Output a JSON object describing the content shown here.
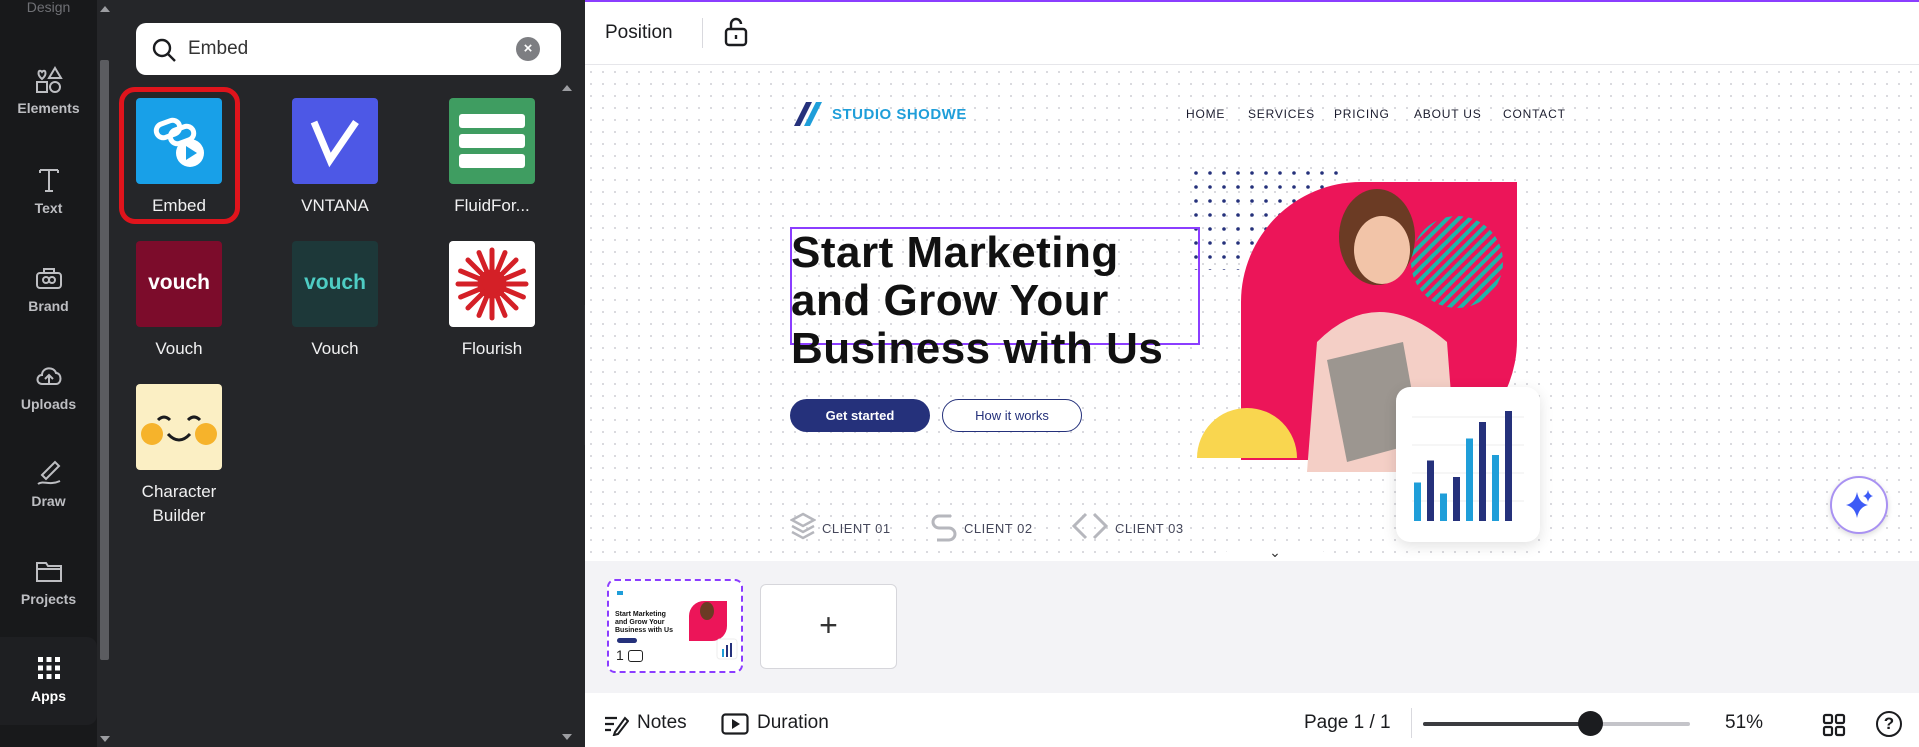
{
  "rail": {
    "top_label": "Design",
    "items": [
      {
        "label": "Elements",
        "icon": "elements-icon"
      },
      {
        "label": "Text",
        "icon": "text-icon"
      },
      {
        "label": "Brand",
        "icon": "brand-icon"
      },
      {
        "label": "Uploads",
        "icon": "uploads-icon"
      },
      {
        "label": "Draw",
        "icon": "draw-icon"
      },
      {
        "label": "Projects",
        "icon": "projects-icon"
      },
      {
        "label": "Apps",
        "icon": "apps-icon",
        "active": true
      }
    ]
  },
  "search": {
    "value": "Embed",
    "placeholder": "Search"
  },
  "apps": [
    {
      "label": "Embed",
      "icon": "embed-icon",
      "color": "#18a0e8",
      "highlighted": true
    },
    {
      "label": "VNTANA",
      "icon": "vntana-icon",
      "color": "#4d58e6"
    },
    {
      "label": "FluidFor...",
      "icon": "fluidforms-icon",
      "color": "#3f9d61"
    },
    {
      "label": "Vouch",
      "icon": "vouch-red-icon",
      "color": "#7c0c2b",
      "logo_text": "vouch"
    },
    {
      "label": "Vouch",
      "icon": "vouch-dark-icon",
      "color": "#1d3839",
      "logo_text": "vouch"
    },
    {
      "label": "Flourish",
      "icon": "flourish-icon",
      "color": "#ffffff"
    },
    {
      "label": "Character Builder",
      "icon": "character-builder-icon",
      "color": "#fbefc4"
    }
  ],
  "toolbar": {
    "position_label": "Position",
    "lock_icon": "lock-open-icon"
  },
  "design": {
    "brand": "STUDIO SHODWE",
    "nav": [
      "HOME",
      "SERVICES",
      "PRICING",
      "ABOUT US",
      "CONTACT"
    ],
    "headline_lines": [
      "Start Marketing",
      "and Grow Your",
      "Business with Us"
    ],
    "primary_cta": "Get started",
    "secondary_cta": "How it works",
    "clients": [
      "CLIENT 01",
      "CLIENT 02",
      "CLIENT 03"
    ],
    "colors": {
      "accent": "#8b3dff",
      "navy": "#25317b",
      "pink": "#ec1559",
      "teal": "#1fb5a8",
      "yellow": "#f9d64f",
      "brand_blue": "#1f9ed9"
    },
    "bar_values": [
      0.35,
      0.55,
      0.25,
      0.4,
      0.75,
      0.9,
      0.6,
      1.0
    ]
  },
  "pages": {
    "current_page_number": "1",
    "add_label": "+"
  },
  "bottombar": {
    "notes_label": "Notes",
    "duration_label": "Duration",
    "page_label": "Page 1 / 1",
    "zoom_label": "51%",
    "zoom_value": 51,
    "help_label": "?"
  }
}
